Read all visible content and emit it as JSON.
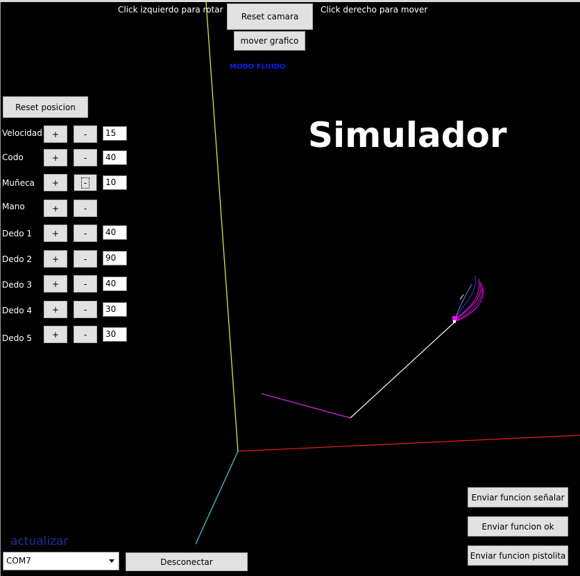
{
  "title": "Simulador",
  "mode_label": "MODO FLUIDO",
  "hints": {
    "left": "Click izquierdo para rotar",
    "right": "Click derecho para mover"
  },
  "camera": {
    "reset_label": "Reset camara",
    "move_label": "mover grafico"
  },
  "reset_position_label": "Reset posicion",
  "plus_label": "+",
  "minus_label": "-",
  "controls": [
    {
      "label": "Velocidad",
      "value": "15"
    },
    {
      "label": "Codo",
      "value": "40"
    },
    {
      "label": "Muñeca",
      "value": "10"
    },
    {
      "label": "Mano",
      "value": null
    },
    {
      "label": "Dedo 1",
      "value": "40"
    },
    {
      "label": "Dedo 2",
      "value": "90"
    },
    {
      "label": "Dedo 3",
      "value": "40"
    },
    {
      "label": "Dedo 4",
      "value": "30"
    },
    {
      "label": "Dedo 5",
      "value": "30"
    }
  ],
  "functions": {
    "point_label": "Enviar funcion señalar",
    "ok_label": "Enviar funcion ok",
    "gun_label": "Enviar funcion pistolita"
  },
  "refresh_link": "actualizar",
  "port": {
    "selected": "COM7",
    "disconnect_label": "Desconectar"
  },
  "colors": {
    "background": "#000000",
    "axis_x": "#e11d1d",
    "axis_y": "#e8e81c",
    "axis_z": "#35c7d8",
    "arm_segment": "#ffffff",
    "forearm": "#c020c0",
    "fingers": "#ff00ff",
    "mode_text": "#0b1ef0"
  }
}
